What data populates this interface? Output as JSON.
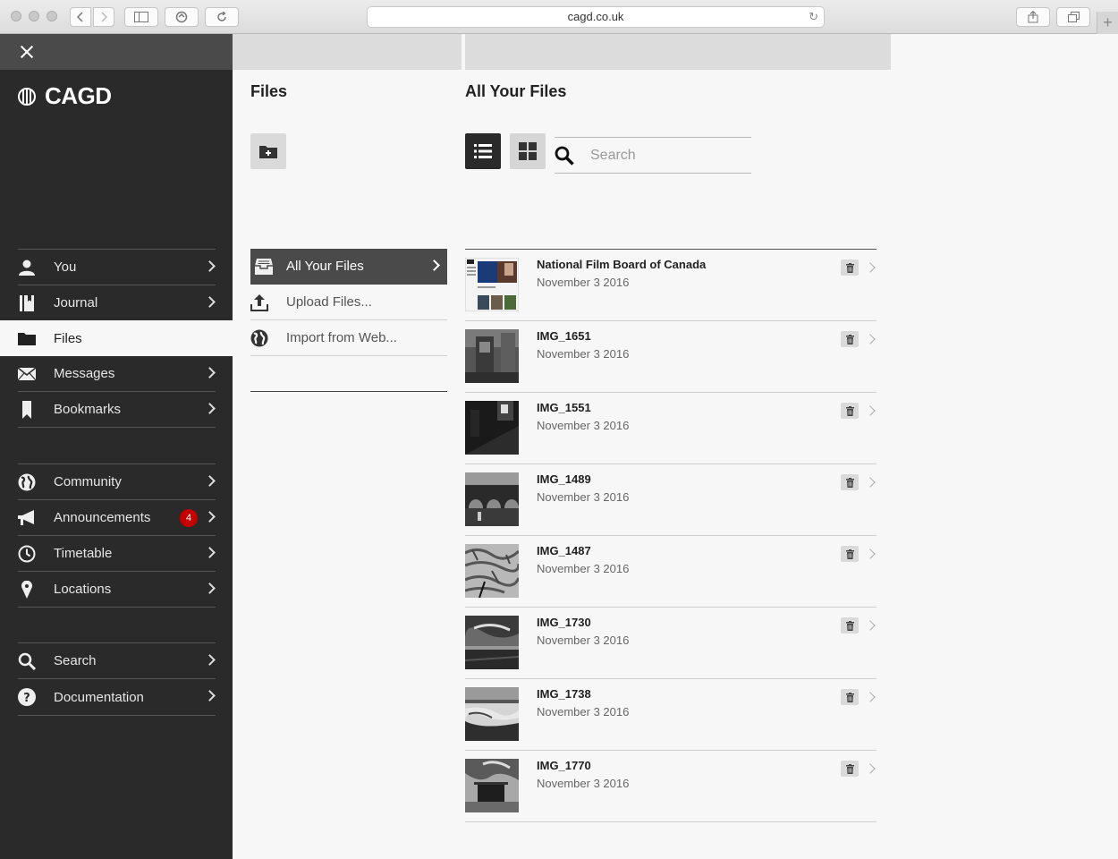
{
  "browser": {
    "url": "cagd.co.uk"
  },
  "sidebar": {
    "brand": "CAGD",
    "group1": [
      {
        "label": "You",
        "icon": "user-icon"
      },
      {
        "label": "Journal",
        "icon": "journal-icon"
      }
    ],
    "active": {
      "label": "Files",
      "icon": "folder-icon"
    },
    "group2": [
      {
        "label": "Messages",
        "icon": "envelope-icon"
      },
      {
        "label": "Bookmarks",
        "icon": "bookmark-icon"
      }
    ],
    "group3": [
      {
        "label": "Community",
        "icon": "globe-icon"
      },
      {
        "label": "Announcements",
        "icon": "megaphone-icon",
        "badge": "4"
      },
      {
        "label": "Timetable",
        "icon": "clock-icon"
      },
      {
        "label": "Locations",
        "icon": "map-pin-icon"
      }
    ],
    "group4": [
      {
        "label": "Search",
        "icon": "search-icon"
      },
      {
        "label": "Documentation",
        "icon": "help-icon"
      }
    ]
  },
  "files_panel": {
    "title": "Files",
    "items": [
      {
        "label": "All Your Files",
        "active": true
      },
      {
        "label": "Upload Files..."
      },
      {
        "label": "Import from Web..."
      }
    ]
  },
  "all_files": {
    "title": "All Your Files",
    "search_placeholder": "Search",
    "files": [
      {
        "name": "National Film Board of Canada",
        "date": "November 3 2016"
      },
      {
        "name": "IMG_1651",
        "date": "November 3 2016"
      },
      {
        "name": "IMG_1551",
        "date": "November 3 2016"
      },
      {
        "name": "IMG_1489",
        "date": "November 3 2016"
      },
      {
        "name": "IMG_1487",
        "date": "November 3 2016"
      },
      {
        "name": "IMG_1730",
        "date": "November 3 2016"
      },
      {
        "name": "IMG_1738",
        "date": "November 3 2016"
      },
      {
        "name": "IMG_1770",
        "date": "November 3 2016"
      }
    ]
  },
  "colors": {
    "sidebar_bg": "#2a2a2a",
    "accent_dark": "#4a4a4a",
    "badge_red": "#c40000",
    "page_bg": "#f7f7f7"
  }
}
